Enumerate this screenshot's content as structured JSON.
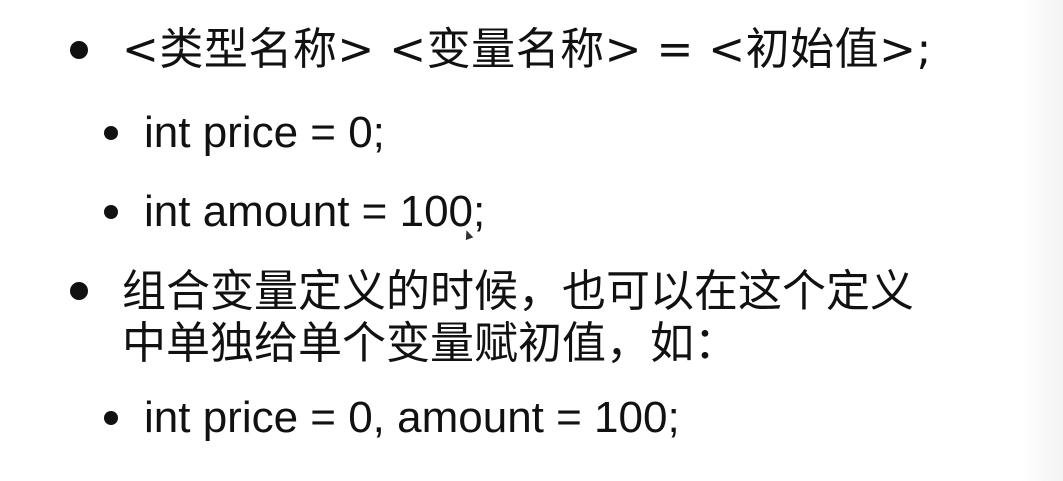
{
  "slide": {
    "bullets": [
      {
        "level": 1,
        "text": "<类型名称> <变量名称> = <初始值>;"
      },
      {
        "level": 2,
        "text": "int price = 0;"
      },
      {
        "level": 2,
        "text": "int amount = 100;"
      },
      {
        "level": 1,
        "lines": [
          "组合变量定义的时候，也可以在这个定义",
          "中单独给单个变量赋初值，如："
        ]
      },
      {
        "level": 2,
        "text": "int price = 0, amount = 100;"
      }
    ]
  }
}
